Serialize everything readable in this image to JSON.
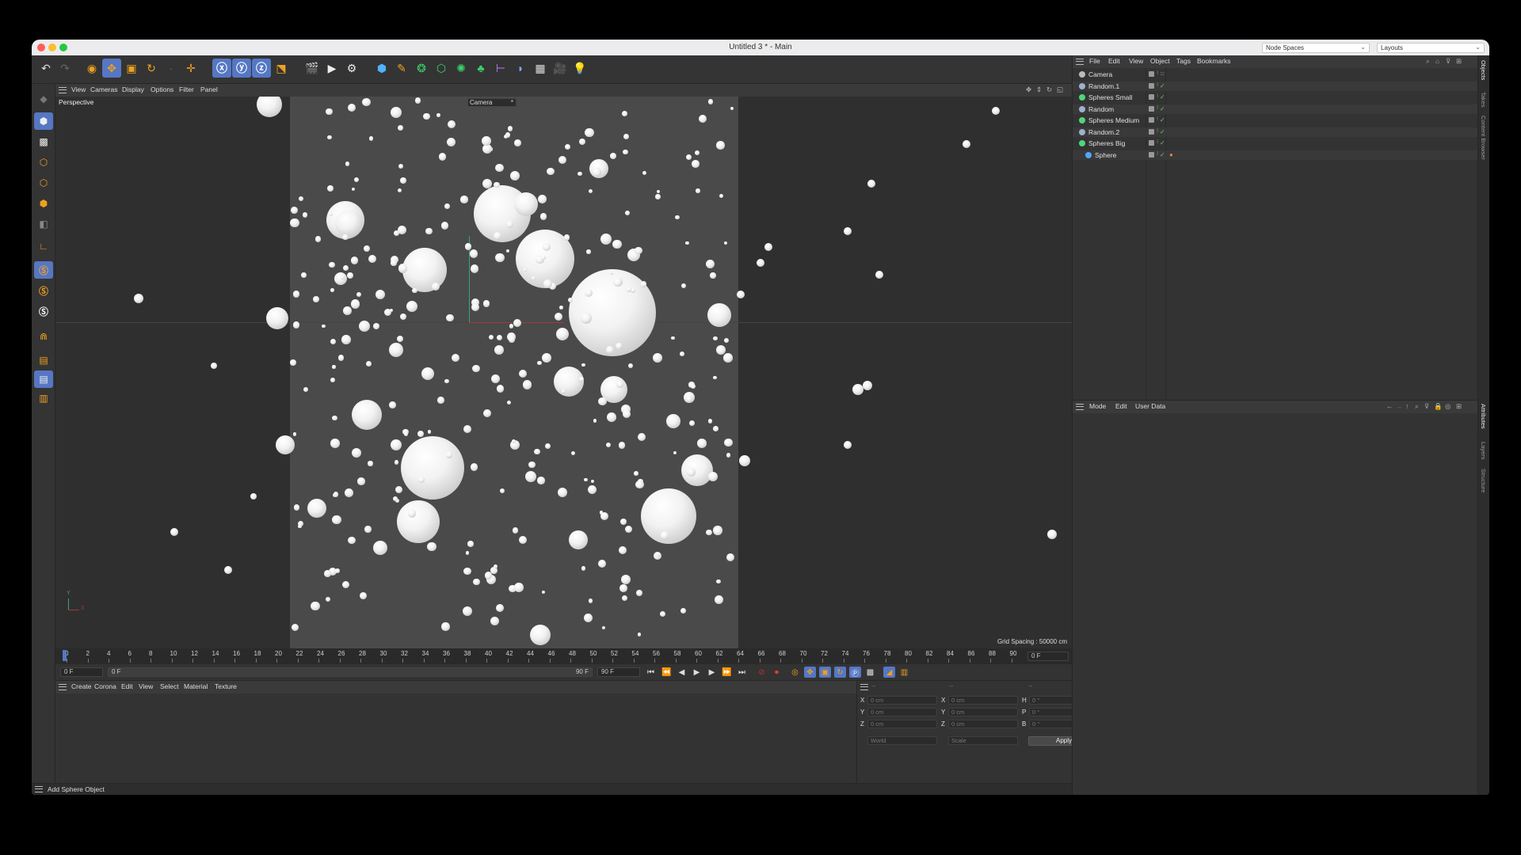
{
  "window": {
    "title": "Untitled 3 * - Main",
    "node_spaces": "Node Spaces",
    "layouts": "Layouts",
    "traffic": [
      "#ff5f57",
      "#febc2e",
      "#28c840"
    ]
  },
  "viewport": {
    "menu": [
      "View",
      "Cameras",
      "Display",
      "Options",
      "Filter",
      "Panel"
    ],
    "label": "Perspective",
    "camera": "Camera",
    "camera_mark": "*",
    "grid_spacing": "Grid Spacing : 50000 cm",
    "axis_y": "Y",
    "axis_x": "X"
  },
  "timeline": {
    "ticks": [
      "0",
      "2",
      "4",
      "6",
      "8",
      "10",
      "12",
      "14",
      "16",
      "18",
      "20",
      "22",
      "24",
      "26",
      "28",
      "30",
      "32",
      "34",
      "36",
      "38",
      "40",
      "42",
      "44",
      "46",
      "48",
      "50",
      "52",
      "54",
      "56",
      "58",
      "60",
      "62",
      "64",
      "66",
      "68",
      "70",
      "72",
      "74",
      "76",
      "78",
      "80",
      "82",
      "84",
      "86",
      "88",
      "90"
    ],
    "current_frame": "0 F",
    "start": "0 F",
    "min": "0 F",
    "max": "90 F",
    "end": "90 F"
  },
  "material_manager": {
    "menu": [
      "Create",
      "Corona",
      "Edit",
      "View",
      "Select",
      "Material",
      "Texture"
    ]
  },
  "coordinates": {
    "headers": [
      "--",
      "--",
      "--"
    ],
    "rows": [
      {
        "l1": "X",
        "v1": "0 cm",
        "l2": "X",
        "v2": "0 cm",
        "l3": "H",
        "v3": "0 °"
      },
      {
        "l1": "Y",
        "v1": "0 cm",
        "l2": "Y",
        "v2": "0 cm",
        "l3": "P",
        "v3": "0 °"
      },
      {
        "l1": "Z",
        "v1": "0 cm",
        "l2": "Z",
        "v2": "0 cm",
        "l3": "B",
        "v3": "0 °"
      }
    ],
    "mode_world": "World",
    "mode_scale": "Scale",
    "apply": "Apply"
  },
  "status": "Add Sphere Object",
  "object_manager": {
    "menu": [
      "File",
      "Edit",
      "View",
      "Object",
      "Tags",
      "Bookmarks"
    ],
    "objects": [
      {
        "name": "Camera",
        "indent": 0,
        "icon": "camera-icon"
      },
      {
        "name": "Random.1",
        "indent": 0,
        "icon": "random-effector-icon"
      },
      {
        "name": "Spheres Small",
        "indent": 0,
        "icon": "cloner-icon"
      },
      {
        "name": "Random",
        "indent": 0,
        "icon": "random-effector-icon"
      },
      {
        "name": "Spheres Medium",
        "indent": 0,
        "icon": "cloner-icon"
      },
      {
        "name": "Random.2",
        "indent": 0,
        "icon": "random-effector-icon"
      },
      {
        "name": "Spheres Big",
        "indent": 0,
        "icon": "cloner-icon"
      },
      {
        "name": "Sphere",
        "indent": 1,
        "icon": "sphere-icon"
      }
    ]
  },
  "attribute_manager": {
    "menu": [
      "Mode",
      "Edit",
      "User Data"
    ]
  },
  "right_tabs_top": [
    "Objects",
    "Takes",
    "Content Browser"
  ],
  "right_tabs_bottom": [
    "Attributes",
    "Layers",
    "Structure"
  ],
  "colors": {
    "accent": "#5577c4",
    "orange": "#f0a020",
    "green_check": "#6ad06a"
  }
}
